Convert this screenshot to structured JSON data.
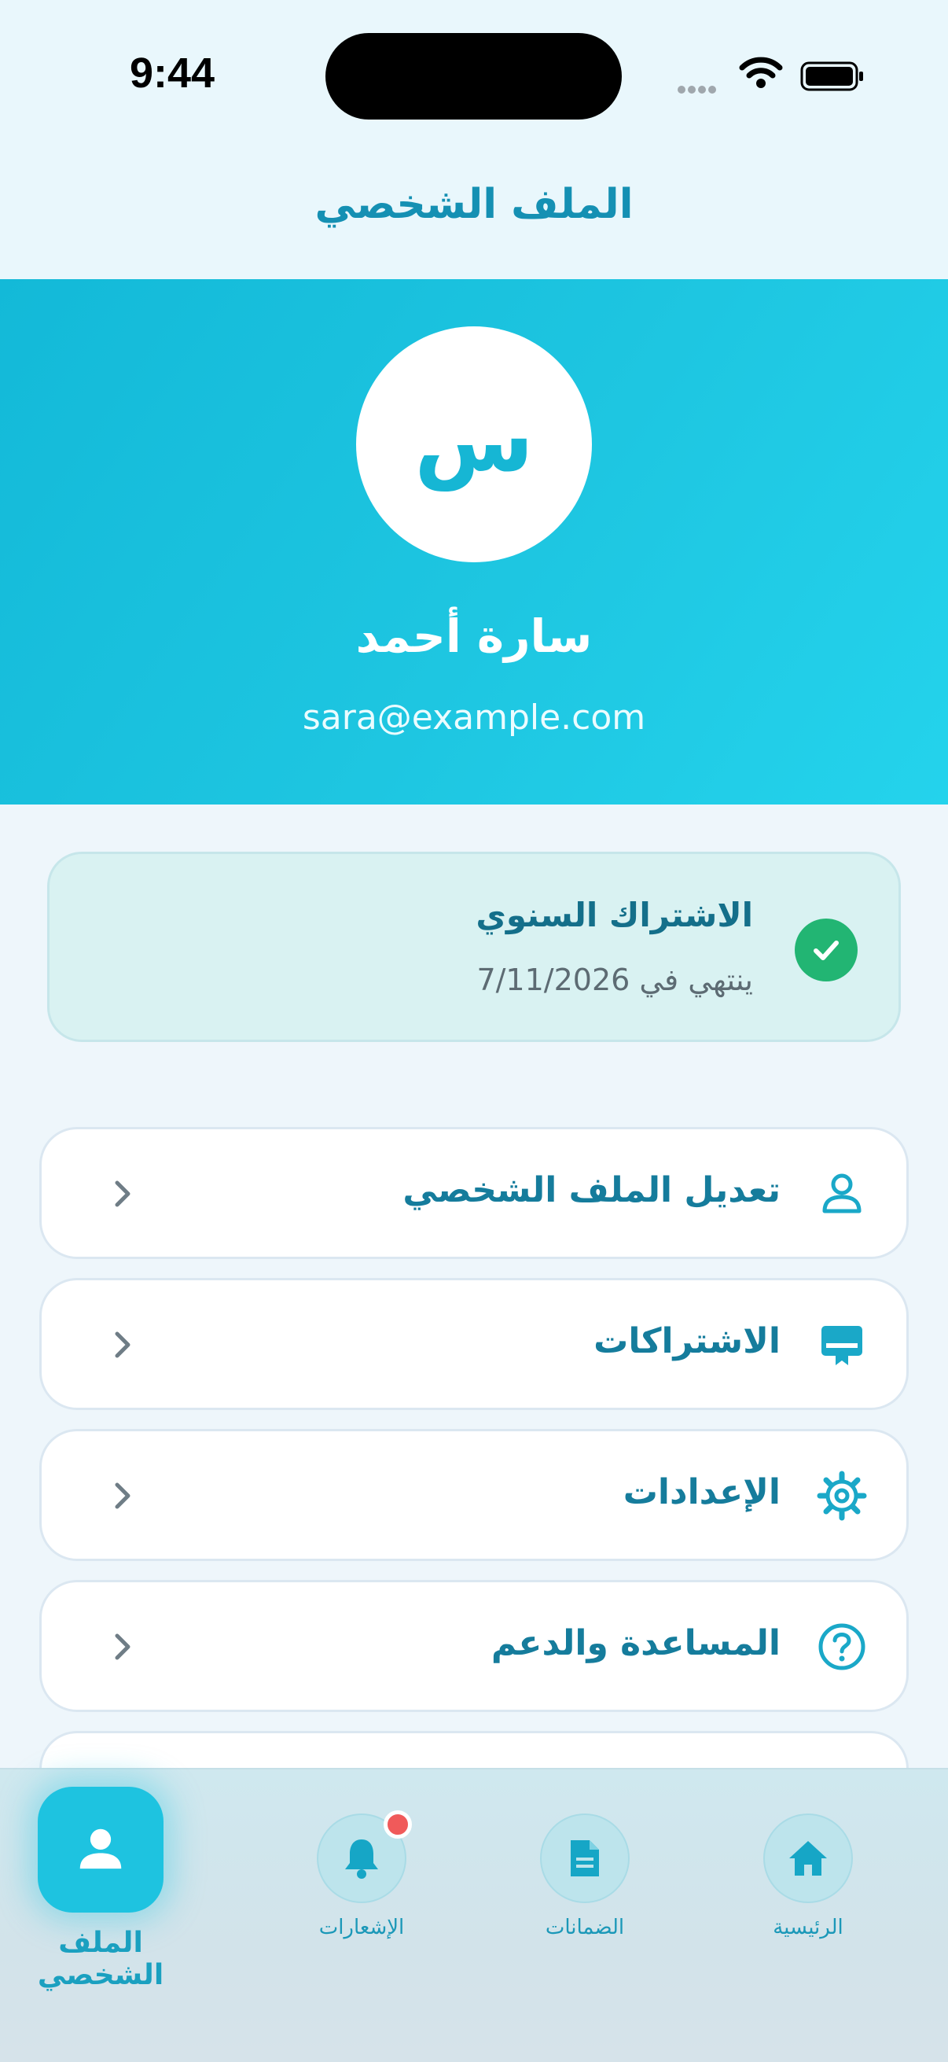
{
  "status_bar": {
    "time": "9:44"
  },
  "header": {
    "title": "الملف الشخصي"
  },
  "profile": {
    "avatar_letter": "س",
    "name": "سارة أحمد",
    "email": "sara@example.com"
  },
  "subscription": {
    "title": "الاشتراك السنوي",
    "expiry": "ينتهي في 7/11/2026",
    "status_icon": "check-circle-icon"
  },
  "menu": {
    "items": [
      {
        "label": "تعديل الملف الشخصي",
        "icon": "user-icon"
      },
      {
        "label": "الاشتراكات",
        "icon": "card-icon"
      },
      {
        "label": "الإعدادات",
        "icon": "gear-icon"
      },
      {
        "label": "المساعدة والدعم",
        "icon": "help-icon"
      }
    ]
  },
  "tabbar": {
    "tabs": [
      {
        "label": "الملف الشخصي",
        "icon": "user-icon",
        "active": true
      },
      {
        "label": "الإشعارات",
        "icon": "bell-icon",
        "active": false,
        "badge": true
      },
      {
        "label": "الضمانات",
        "icon": "document-icon",
        "active": false
      },
      {
        "label": "الرئيسية",
        "icon": "home-icon",
        "active": false
      }
    ]
  },
  "colors": {
    "accent": "#1ec3e0",
    "primary_text": "#157c9c",
    "success": "#22b573",
    "badge": "#f05a5a"
  }
}
